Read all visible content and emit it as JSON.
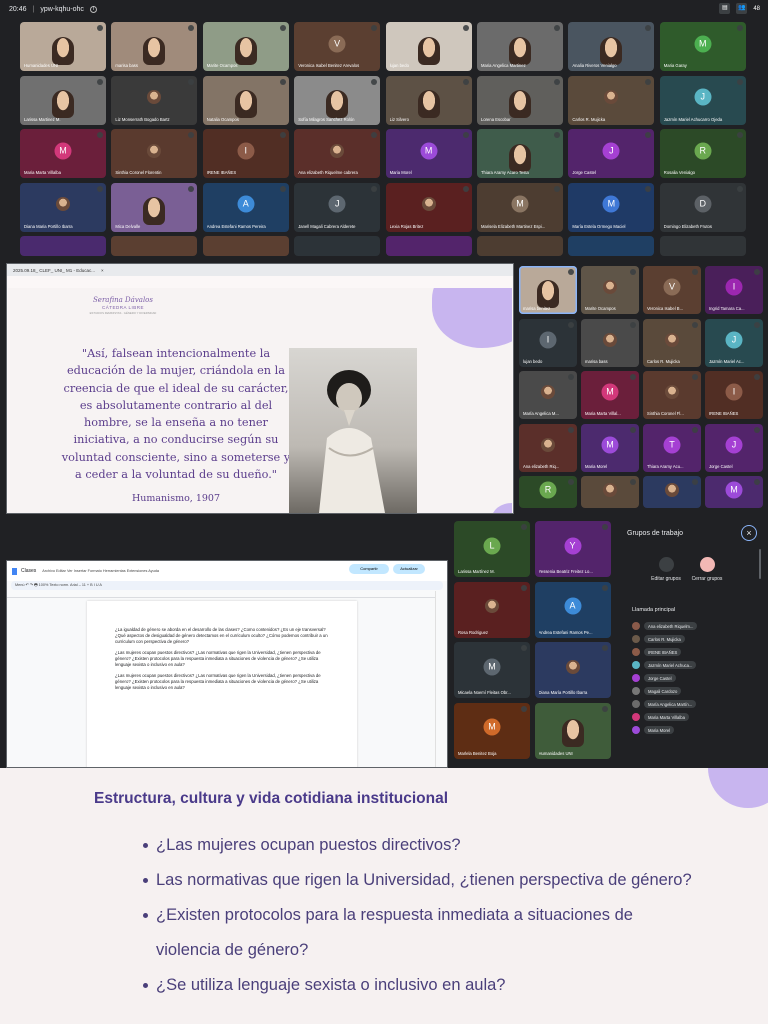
{
  "topbar": {
    "time": "20:46",
    "meeting_code": "ypw-kqhu-ohc",
    "participant_count": "48"
  },
  "grid_top": [
    {
      "name": "Humanidades UNI",
      "kind": "face",
      "bg": "#b9a999"
    },
    {
      "name": "marisa bass",
      "kind": "face",
      "bg": "#a08b7b"
    },
    {
      "name": "Marite Ocampos",
      "kind": "face",
      "bg": "#8f9c87"
    },
    {
      "name": "Veronica Isabel Benitez Arevalos",
      "kind": "avatar",
      "letter": "V",
      "color": "#8a6b56",
      "bg": "#5b3f31"
    },
    {
      "name": "lujan bedo",
      "kind": "face",
      "bg": "#cfc7bd"
    },
    {
      "name": "Maria Angelica Martinez",
      "kind": "face",
      "bg": "#6b6b6b"
    },
    {
      "name": "Analia Riveros Venialgo",
      "kind": "face",
      "bg": "#4a5560"
    },
    {
      "name": "Maria Garay",
      "kind": "avatar",
      "letter": "M",
      "color": "#4caf50",
      "bg": "#2f5b2b"
    },
    {
      "name": "Larissa Martinez M.",
      "kind": "face",
      "bg": "#707070"
    },
    {
      "name": "Liz Monserrath Bogado Bartz",
      "kind": "photo",
      "bg": "#3a3a3a"
    },
    {
      "name": "Natalia Ocampos",
      "kind": "face",
      "bg": "#837466"
    },
    {
      "name": "Sofía Milagros Sanchez Rolón",
      "kind": "face",
      "bg": "#8b8b8b"
    },
    {
      "name": "Liz Silvero",
      "kind": "face",
      "bg": "#5d5145"
    },
    {
      "name": "Lorena Escobar",
      "kind": "face",
      "bg": "#605f5c"
    },
    {
      "name": "Carlos R. Mujicka",
      "kind": "photo",
      "bg": "#5a4a3b"
    },
    {
      "name": "Jazmín Mariel Achucarro Ojeda",
      "kind": "avatar",
      "letter": "J",
      "color": "#5ab5c4",
      "bg": "#284a50"
    },
    {
      "name": "Maria Marta Villalba",
      "kind": "avatar",
      "letter": "M",
      "color": "#d2387a",
      "bg": "#6b1f3b"
    },
    {
      "name": "Sinthia Coronel Florentin",
      "kind": "photo",
      "bg": "#5a3a2e"
    },
    {
      "name": "IRENE IBAÑES",
      "kind": "avatar",
      "letter": "I",
      "color": "#8c5b48",
      "bg": "#512e24"
    },
    {
      "name": "Ana elizabeth Riquelme cabrera",
      "kind": "photo",
      "bg": "#5b2f2a"
    },
    {
      "name": "Maria Morel",
      "kind": "avatar",
      "letter": "M",
      "color": "#9c4bd9",
      "bg": "#4c2a6e"
    },
    {
      "name": "Thiara Aramy Acaro Testa",
      "kind": "face",
      "bg": "#3f5c4b"
    },
    {
      "name": "Jorge Castel",
      "kind": "avatar",
      "letter": "J",
      "color": "#a540d3",
      "bg": "#53246b"
    },
    {
      "name": "Rosalia Venialgo",
      "kind": "avatar",
      "letter": "R",
      "color": "#6aa84f",
      "bg": "#2c4a27"
    },
    {
      "name": "Diana Maria Portillo Ibarra",
      "kind": "photo",
      "bg": "#2c3a60"
    },
    {
      "name": "Mica Delvalle",
      "kind": "face",
      "bg": "#7a5f95"
    },
    {
      "name": "Andrea Estefani Ramos Pereira",
      "kind": "avatar",
      "letter": "A",
      "color": "#3d8bd8",
      "bg": "#1f3f63"
    },
    {
      "name": "Janell Magali Cabrera Alderete",
      "kind": "avatar",
      "letter": "J",
      "color": "#5d6770",
      "bg": "#2c3338"
    },
    {
      "name": "Lexia Rojas Britez",
      "kind": "photo",
      "bg": "#5a2020"
    },
    {
      "name": "Marisela Elizabeth Martinez Espi...",
      "kind": "avatar",
      "letter": "M",
      "color": "#8a7562",
      "bg": "#4d3d31"
    },
    {
      "name": "María Estela Ormego Maciel",
      "kind": "avatar",
      "letter": "M",
      "color": "#3f78d6",
      "bg": "#1f3a66"
    },
    {
      "name": "Domingo Elizabeth Frutos",
      "kind": "avatar",
      "letter": "D",
      "color": "#5c6166",
      "bg": "#303437"
    }
  ],
  "presentation": {
    "window_title": "2025.09.18_ CLEF_ UNI_ M1 - Educac...",
    "close_label": "×",
    "logo_line1": "Serafina Dávalos",
    "logo_line2": "CÁTEDRA LIBRE",
    "logo_line3": "ESTUDIOS FEMINISTAS · GÉNERO Y DIVERSIDAD",
    "quote": "\"Así, falsean intencionalmente la educación de la mujer, criándola en la creencia de que el ideal de su carácter, es absolutamente contrario al del hombre, se la enseña a no tener iniciativa, a no conducirse según su voluntad consciente, sino a someterse y a ceder a la voluntad de su dueño.\"",
    "source": "Humanismo, 1907"
  },
  "grid_side": [
    {
      "name": "marisa benitez",
      "kind": "face",
      "bg": "#b9a999",
      "active": true
    },
    {
      "name": "Marite Ocampos",
      "kind": "photo",
      "bg": "#5f5548"
    },
    {
      "name": "Veronica Isabel B...",
      "kind": "avatar",
      "letter": "V",
      "color": "#8a6b56",
      "bg": "#5b3f31"
    },
    {
      "name": "Ingrid Tamara Ca...",
      "kind": "avatar",
      "letter": "I",
      "color": "#9c27b0",
      "bg": "#4a1f5a"
    },
    {
      "name": "lujan bedo",
      "kind": "avatar",
      "letter": "I",
      "color": "#5d6770",
      "bg": "#2c3338"
    },
    {
      "name": "marisa bass",
      "kind": "photo",
      "bg": "#4a4a4a"
    },
    {
      "name": "Carlos R. Mujicka",
      "kind": "photo",
      "bg": "#5a4a3b"
    },
    {
      "name": "Jazmín Mariel Ac...",
      "kind": "avatar",
      "letter": "J",
      "color": "#5ab5c4",
      "bg": "#284a50"
    },
    {
      "name": "María Angelica M...",
      "kind": "photo",
      "bg": "#4a4a4a"
    },
    {
      "name": "Maria Marta Villal...",
      "kind": "avatar",
      "letter": "M",
      "color": "#d2387a",
      "bg": "#6b1f3b"
    },
    {
      "name": "Sinthia Coronel Fl...",
      "kind": "photo",
      "bg": "#5a3a2e"
    },
    {
      "name": "IRENE IBAÑES",
      "kind": "avatar",
      "letter": "I",
      "color": "#8c5b48",
      "bg": "#512e24"
    },
    {
      "name": "Ana elizabeth Riq...",
      "kind": "photo",
      "bg": "#5b2f2a"
    },
    {
      "name": "Maria Morel",
      "kind": "avatar",
      "letter": "M",
      "color": "#9c4bd9",
      "bg": "#4c2a6e"
    },
    {
      "name": "Thiara Aramy Acu...",
      "kind": "avatar",
      "letter": "T",
      "color": "#a540d3",
      "bg": "#53246b"
    },
    {
      "name": "Jorge Castel",
      "kind": "avatar",
      "letter": "J",
      "color": "#a540d3",
      "bg": "#53246b"
    },
    {
      "name": "",
      "kind": "avatar",
      "letter": "R",
      "color": "#6aa84f",
      "bg": "#2c4a27"
    },
    {
      "name": "",
      "kind": "photo",
      "bg": "#5a4a3b"
    },
    {
      "name": "",
      "kind": "photo",
      "bg": "#2c3a60"
    },
    {
      "name": "",
      "kind": "avatar",
      "letter": "M",
      "color": "#9c4bd9",
      "bg": "#4c2a6e"
    }
  ],
  "gdoc": {
    "title": "Clases",
    "menu": "Archivo  Editar  Ver  Insertar  Formato  Herramientas  Extensiones  Ayuda",
    "toolbar": "Menú   ↶  ↷  🖶   100%   Texto norm.   Arial   –  11  +   B  I  U  A",
    "share_label": "Compartir",
    "update_label": "Actualizar",
    "paragraphs": [
      "¿La igualdad de género se aborda en el desarrollo de las clases? ¿Como contenidos? ¿Es un eje transversal?¿Qué aspectos de desigualdad de género detectamos en el curriculum oculto? ¿Cómo podemos contribuir a un curriculum con perspectiva de género?",
      "¿Las mujeres ocupan puestos directivos? ¿Las normativas que rigen la Universidad, ¿tienen perspectiva de género? ¿Existen protocolos para la respuesta inmediata a situaciones de violencia de género? ¿Se utiliza lenguaje sexista o inclusivo en aula?",
      "¿Las mujeres ocupan puestos directivos? ¿Las normativas que rigen la Universidad, ¿tienen perspectiva de género? ¿Existen protocolos para la respuesta inmediata a situaciones de violencia de género? ¿Se utiliza lenguaje sexista o inclusivo en aula?"
    ]
  },
  "grid_bottom": [
    {
      "name": "Larissa Martínez M.",
      "kind": "avatar",
      "letter": "L",
      "color": "#6aa84f",
      "bg": "#2c4a27"
    },
    {
      "name": "Yessenia Beatriz Freitez Lo...",
      "kind": "avatar",
      "letter": "Y",
      "color": "#a540d3",
      "bg": "#53246b"
    },
    {
      "name": "Rosa Rodriguez",
      "kind": "photo",
      "bg": "#5a2020"
    },
    {
      "name": "Andrea Estefani Ramos Pe...",
      "kind": "avatar",
      "letter": "A",
      "color": "#3d8bd8",
      "bg": "#1f3f63"
    },
    {
      "name": "Micaela Noemí Fleitas Obr...",
      "kind": "avatar",
      "letter": "M",
      "color": "#5d6770",
      "bg": "#2c3338"
    },
    {
      "name": "Diana María Portillo Ibarra",
      "kind": "photo",
      "bg": "#2c3a60"
    },
    {
      "name": "Marlela Benitez Boja",
      "kind": "avatar",
      "letter": "M",
      "color": "#d06a2a",
      "bg": "#5e2d14"
    },
    {
      "name": "Humanidades UNI",
      "kind": "face",
      "bg": "#3f5c3a"
    }
  ],
  "groups_panel": {
    "title": "Grupos de trabajo",
    "close": "×",
    "edit_label": "Editar grupos",
    "close_groups_label": "Cerrar grupos",
    "main_call_label": "Llamada principal",
    "participants": [
      {
        "name": "Ana elizabeth Riquelm...",
        "color": "#8a5a4a"
      },
      {
        "name": "Carlos R. Mujicka",
        "color": "#6b5a4a"
      },
      {
        "name": "IRENE IBAÑES",
        "color": "#8c5b48"
      },
      {
        "name": "Jazmín Mariel Achuca...",
        "color": "#5ab5c4"
      },
      {
        "name": "Jorge Castel",
        "color": "#a540d3"
      },
      {
        "name": "Magali Cardozo",
        "color": "#777777"
      },
      {
        "name": "María Angelica Martín...",
        "color": "#6b6b6b"
      },
      {
        "name": "Maria Marta Villalba",
        "color": "#d2387a"
      },
      {
        "name": "Maria Morel",
        "color": "#9c4bd9"
      }
    ]
  },
  "bottom_slide": {
    "heading": "Estructura, cultura y vida cotidiana institucional",
    "bullets": [
      "¿Las mujeres ocupan puestos directivos?",
      "Las normativas que rigen la Universidad, ¿tienen perspectiva de género?",
      "¿Existen protocolos para la respuesta inmediata a situaciones de violencia de género?",
      "¿Se utiliza lenguaje sexista o inclusivo en aula?"
    ]
  }
}
